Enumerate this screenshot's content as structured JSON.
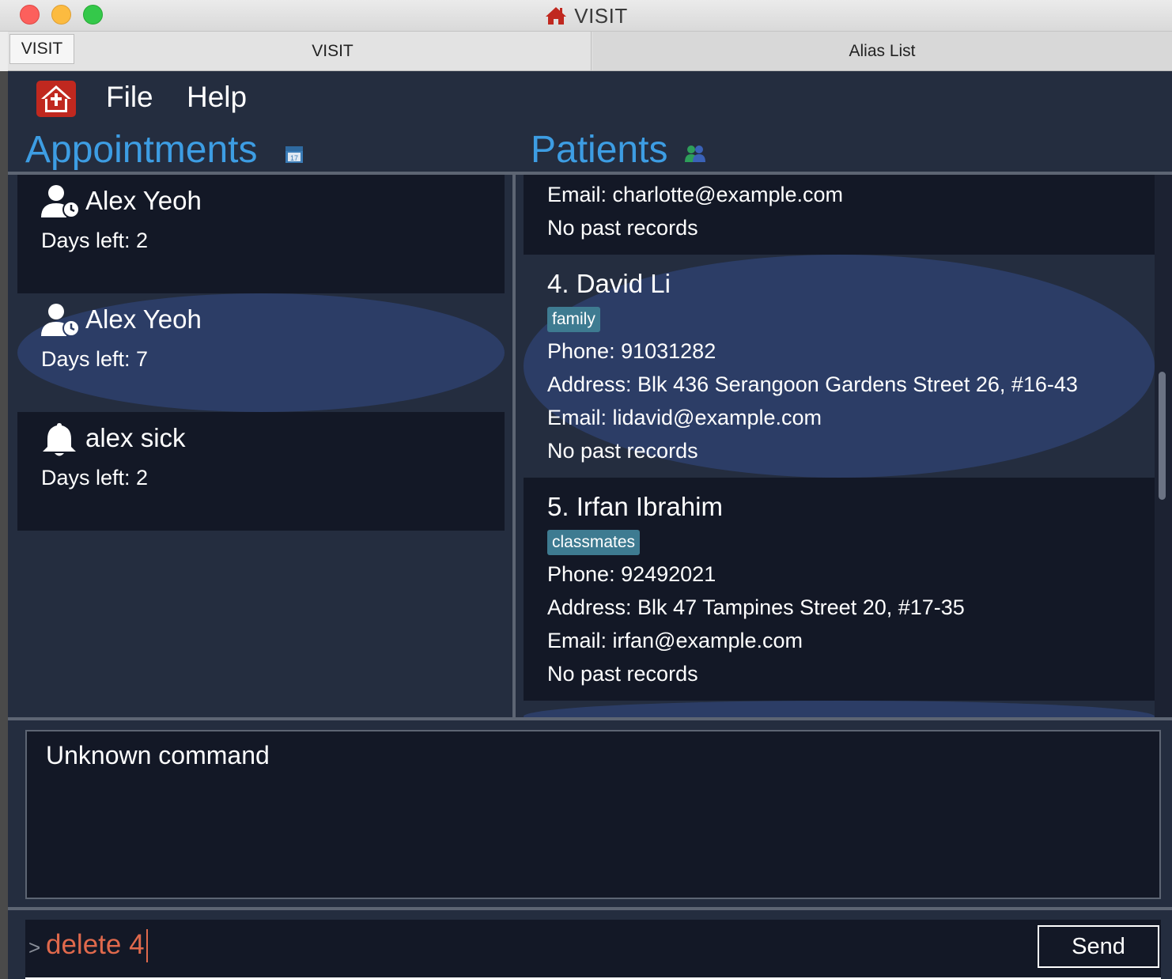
{
  "window": {
    "title": "VISIT"
  },
  "tabs": {
    "mini": "VISIT",
    "items": [
      {
        "label": "VISIT"
      },
      {
        "label": "Alias List"
      }
    ]
  },
  "menu": {
    "items": [
      {
        "label": "File"
      },
      {
        "label": "Help"
      }
    ]
  },
  "appointments": {
    "title": "Appointments",
    "items": [
      {
        "icon": "person-clock-icon",
        "name": "Alex Yeoh",
        "days": "Days left: 2"
      },
      {
        "icon": "person-clock-icon",
        "name": "Alex Yeoh",
        "days": "Days left: 7"
      },
      {
        "icon": "bell-icon",
        "name": "alex sick",
        "days": "Days left: 2"
      }
    ]
  },
  "patients": {
    "title": "Patients",
    "partial": {
      "email": "Email: charlotte@example.com",
      "records": "No past records"
    },
    "items": [
      {
        "name": "4.  David Li",
        "tag": "family",
        "phone": "Phone: 91031282",
        "address": "Address: Blk 436 Serangoon Gardens Street 26, #16-43",
        "email": "Email: lidavid@example.com",
        "records": "No past records"
      },
      {
        "name": "5.  Irfan Ibrahim",
        "tag": "classmates",
        "phone": "Phone: 92492021",
        "address": "Address: Blk 47 Tampines Street 20, #17-35",
        "email": "Email: irfan@example.com",
        "records": "No past records"
      }
    ]
  },
  "result": {
    "text": "Unknown command"
  },
  "command": {
    "prompt": ">",
    "value": "delete 4",
    "send_label": "Send"
  },
  "colors": {
    "accent": "#3d9de3",
    "panel": "#242d3f",
    "card_dark": "#131826",
    "card_selected": "#2c3d66",
    "tag": "#3e7b91",
    "command_text": "#e0694c"
  }
}
